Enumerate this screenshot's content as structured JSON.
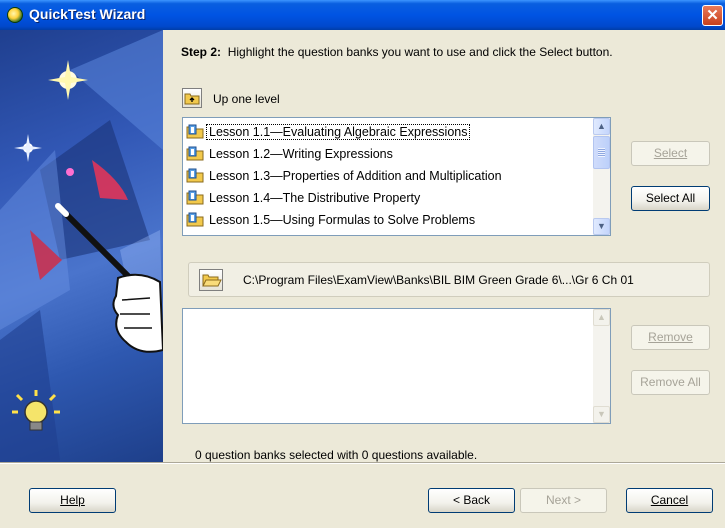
{
  "window": {
    "title": "QuickTest Wizard",
    "close_glyph": "✕"
  },
  "step": {
    "label": "Step 2:",
    "instruction": "Highlight the question banks you want to use and click the Select button."
  },
  "up_level": {
    "label": "Up one level",
    "icon": "folder-up-icon"
  },
  "available_banks": [
    "Lesson 1.1—Evaluating Algebraic Expressions",
    "Lesson 1.2—Writing Expressions",
    "Lesson 1.3—Properties of Addition and Multiplication",
    "Lesson 1.4—The Distributive Property",
    "Lesson 1.5—Using Formulas to Solve Problems"
  ],
  "selected_index": 0,
  "buttons": {
    "select": "Select",
    "select_all": "Select All",
    "remove": "Remove",
    "remove_all": "Remove All",
    "help": "Help",
    "back": "< Back",
    "next": "Next >",
    "cancel": "Cancel"
  },
  "path": {
    "value": "C:\\Program Files\\ExamView\\Banks\\BIL BIM Green Grade 6\\...\\Gr 6 Ch 01",
    "icon": "folder-open-icon"
  },
  "status": "0 question banks selected with 0 questions available.",
  "colors": {
    "titlebar": "#0054e3",
    "window_bg": "#ece9d8",
    "button_border": "#003c74",
    "list_border": "#7f9db9"
  }
}
